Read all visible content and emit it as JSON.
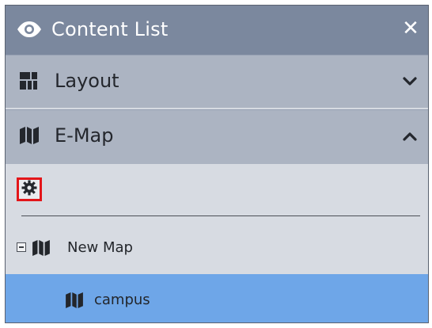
{
  "panel": {
    "title": "Content List",
    "close_glyph": "✕"
  },
  "sections": [
    {
      "label": "Layout",
      "icon": "layout-grid-icon",
      "state": "collapsed"
    },
    {
      "label": "E-Map",
      "icon": "map-icon",
      "state": "expanded"
    }
  ],
  "toolbar": {
    "settings_icon": "gear-icon",
    "highlight_color": "#e3161a"
  },
  "tree": {
    "root": {
      "label": "New Map",
      "expanded": true
    },
    "children": [
      {
        "label": "campus",
        "selected": true
      }
    ]
  },
  "colors": {
    "titlebar": "#7b889e",
    "section_header": "#acb4c2",
    "body": "#d7dbe2",
    "selection": "#6ea6e8"
  }
}
